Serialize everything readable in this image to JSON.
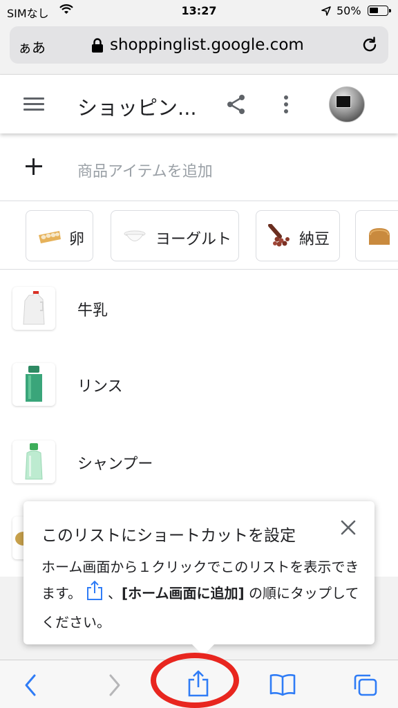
{
  "status_bar": {
    "carrier": "SIMなし",
    "time": "13:27",
    "battery": "50%"
  },
  "browser": {
    "text_size_button": "ぁあ",
    "domain": "shoppinglist.google.com"
  },
  "app_header": {
    "title": "ショッピン..."
  },
  "add_item": {
    "placeholder": "商品アイテムを追加"
  },
  "suggestions": [
    {
      "label": "卵",
      "icon": "egg-carton-icon"
    },
    {
      "label": "ヨーグルト",
      "icon": "yogurt-icon"
    },
    {
      "label": "納豆",
      "icon": "natto-icon"
    },
    {
      "label": "",
      "icon": "bread-icon"
    }
  ],
  "list_items": [
    {
      "name": "牛乳",
      "icon": "milk-jug-icon"
    },
    {
      "name": "リンス",
      "icon": "conditioner-bottle-icon"
    },
    {
      "name": "シャンプー",
      "icon": "shampoo-bottle-icon"
    }
  ],
  "tooltip": {
    "title": "このリストにショートカットを設定",
    "body_line1": "ホーム画面から１クリックでこのリストを表示できます。",
    "body_sep": "、",
    "body_bold_open": "[",
    "body_bold": "ホーム画面に追加",
    "body_bold_close": "]",
    "body_end": " の順にタップしてください。"
  },
  "colors": {
    "accent_blue": "#1a73e8",
    "safari_blue": "#2f7cf6",
    "highlight_red": "#e8261f"
  }
}
